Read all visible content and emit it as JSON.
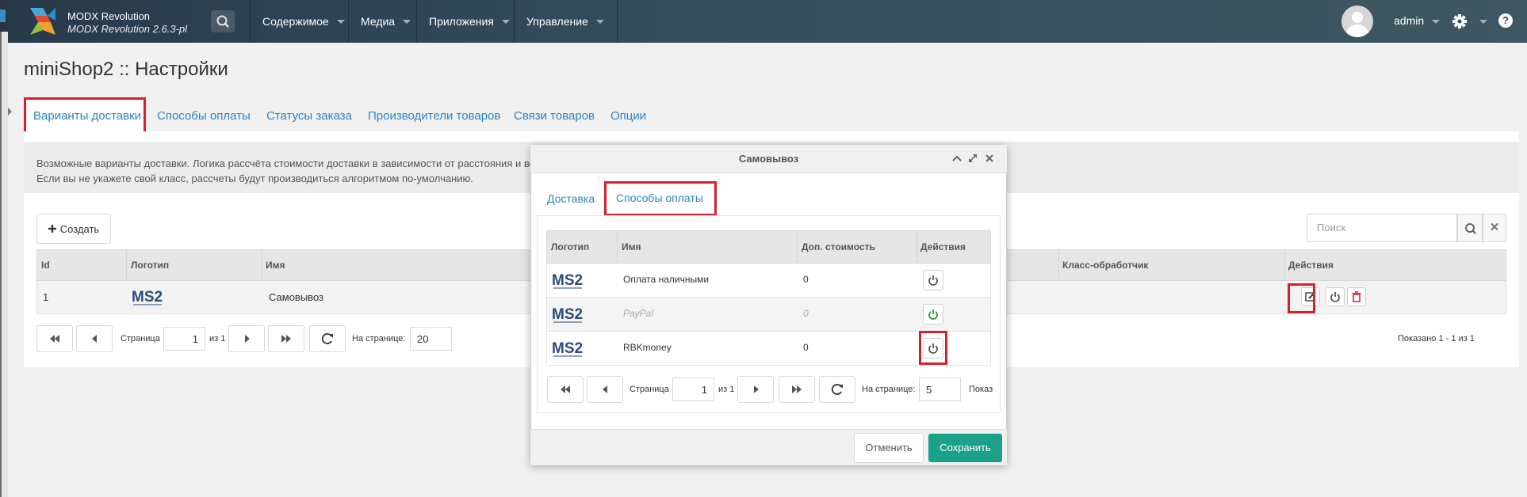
{
  "header": {
    "brand_name": "MODX Revolution",
    "brand_version": "MODX Revolution 2.6.3-pl",
    "nav": [
      {
        "label": "Содержимое"
      },
      {
        "label": "Медиа"
      },
      {
        "label": "Приложения"
      },
      {
        "label": "Управление"
      }
    ],
    "username": "admin",
    "help_glyph": "?"
  },
  "page": {
    "title": "miniShop2 :: Настройки",
    "tabs": [
      {
        "label": "Варианты доставки",
        "active": true
      },
      {
        "label": "Способы оплаты"
      },
      {
        "label": "Статусы заказа"
      },
      {
        "label": "Производители товаров"
      },
      {
        "label": "Связи товаров"
      },
      {
        "label": "Опции"
      }
    ],
    "description_line1": "Возможные варианты доставки. Логика рассчёта стоимости доставки в зависимости от расстояния и ве",
    "description_line2": "Если вы не укажете свой класс, рассчеты будут производиться алгоритмом по-умолчанию.",
    "create_label": "Создать",
    "search_placeholder": "Поиск",
    "grid": {
      "columns": [
        "Id",
        "Логотип",
        "Имя",
        "Класс-обработчик",
        "Действия"
      ],
      "rows": [
        {
          "id": "1",
          "logo": "MS2",
          "name": "Самовывоз"
        }
      ]
    },
    "pager": {
      "page_label": "Страница",
      "page_value": "1",
      "of_label": "из 1",
      "per_page_label": "На странице:",
      "per_page_value": "20",
      "shown": "Показано 1 - 1 из 1"
    }
  },
  "modal": {
    "title": "Самовывоз",
    "tabs": [
      {
        "label": "Доставка"
      },
      {
        "label": "Способы оплаты",
        "active": true
      }
    ],
    "grid": {
      "columns": [
        "Логотип",
        "Имя",
        "Доп. стоимость",
        "Действия"
      ],
      "rows": [
        {
          "logo": "MS2",
          "name": "Оплата наличными",
          "cost": "0",
          "enabled": false
        },
        {
          "logo": "MS2",
          "name": "PayPal",
          "cost": "0",
          "enabled": true
        },
        {
          "logo": "MS2",
          "name": "RBKmoney",
          "cost": "0",
          "enabled": false
        }
      ]
    },
    "pager": {
      "page_label": "Страница",
      "page_value": "1",
      "of_label": "из 1",
      "per_page_label": "На странице:",
      "per_page_value": "5",
      "shown_partial": "Показ"
    },
    "cancel_label": "Отменить",
    "save_label": "Сохранить"
  },
  "colors": {
    "accent": "#2b84c4",
    "highlight": "#d9202a",
    "save": "#1ba08a",
    "ms2_blue": "#2a4a7a"
  },
  "icons": [
    "search-icon",
    "chevron-down-icon",
    "user-avatar-icon",
    "gear-icon",
    "help-icon",
    "plus-icon",
    "close-icon",
    "edit-icon",
    "power-icon",
    "trash-icon",
    "first-page-icon",
    "prev-page-icon",
    "next-page-icon",
    "last-page-icon",
    "refresh-icon",
    "collapse-icon",
    "maximize-icon"
  ]
}
